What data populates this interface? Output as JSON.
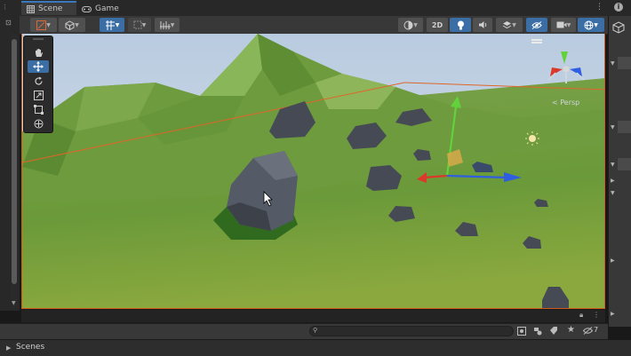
{
  "tabs": [
    {
      "label": "Scene",
      "icon": "grid-icon",
      "active": true
    },
    {
      "label": "Game",
      "icon": "gamepad-icon",
      "active": false
    }
  ],
  "toolbar": {
    "view_2d_label": "2D"
  },
  "tools": [
    "hand-tool-icon",
    "move-tool-icon",
    "rotate-tool-icon",
    "scale-tool-icon",
    "rect-tool-icon",
    "transform-tool-icon"
  ],
  "active_tool": "move-tool-icon",
  "gizmo": {
    "projection_label": "< Persp"
  },
  "bottom": {
    "search_placeholder": "",
    "hidden_count": "7"
  },
  "scenes_panel": {
    "label": "Scenes"
  },
  "colors": {
    "accent": "#3a6ea5",
    "x_axis": "#d93a2b",
    "y_axis": "#61d23c",
    "z_axis": "#2f5fe0",
    "ground": "#6a9a3a",
    "sky": "#c9d9ea",
    "selection": "#d05a1a"
  }
}
